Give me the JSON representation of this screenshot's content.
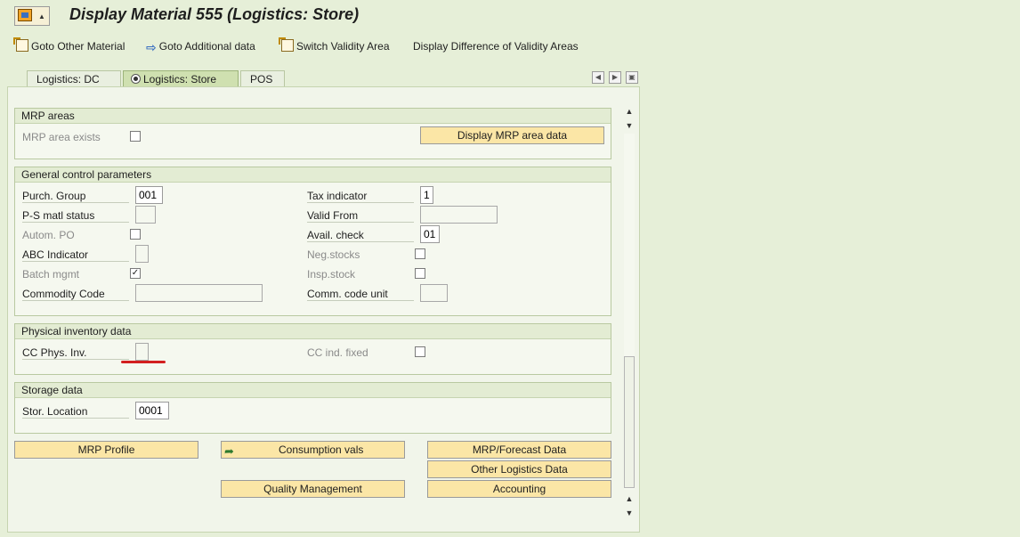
{
  "window": {
    "title": "Display Material 555 (Logistics: Store)"
  },
  "toolbar": {
    "items": [
      {
        "label": "Goto Other Material",
        "icon": "document-icon"
      },
      {
        "label": "Goto Additional data",
        "icon": "arrow-right-icon"
      },
      {
        "label": "Switch Validity Area",
        "icon": "document-icon"
      },
      {
        "label": "Display Difference of Validity Areas",
        "icon": ""
      }
    ]
  },
  "tabs": [
    {
      "label": "Logistics: DC",
      "active": false
    },
    {
      "label": "Logistics: Store",
      "active": true
    },
    {
      "label": "POS",
      "active": false
    }
  ],
  "mrp_areas": {
    "title": "MRP areas",
    "mrp_area_exists_label": "MRP area exists",
    "mrp_area_exists_checked": false,
    "display_button": "Display MRP area data"
  },
  "general": {
    "title": "General control parameters",
    "purch_group": {
      "label": "Purch. Group",
      "value": "001"
    },
    "ps_matl_status": {
      "label": "P-S matl status",
      "value": ""
    },
    "autom_po": {
      "label": "Autom. PO",
      "checked": false
    },
    "abc_indicator": {
      "label": "ABC Indicator",
      "value": ""
    },
    "batch_mgmt": {
      "label": "Batch mgmt",
      "checked": true,
      "mark": "✓"
    },
    "commodity_code": {
      "label": "Commodity Code",
      "value": ""
    },
    "tax_indicator": {
      "label": "Tax indicator",
      "value": "1"
    },
    "valid_from": {
      "label": "Valid From",
      "value": ""
    },
    "avail_check": {
      "label": "Avail. check",
      "value": "01"
    },
    "neg_stocks": {
      "label": "Neg.stocks",
      "checked": false
    },
    "insp_stock": {
      "label": "Insp.stock",
      "checked": false
    },
    "comm_code_unit": {
      "label": "Comm. code unit",
      "value": ""
    }
  },
  "physical_inventory": {
    "title": "Physical inventory data",
    "cc_phys_inv": {
      "label": "CC Phys. Inv.",
      "value": ""
    },
    "cc_ind_fixed": {
      "label": "CC ind. fixed",
      "checked": false
    }
  },
  "storage": {
    "title": "Storage data",
    "stor_location": {
      "label": "Stor. Location",
      "value": "0001"
    }
  },
  "buttons": {
    "mrp_profile": "MRP Profile",
    "consumption_vals": "Consumption vals",
    "mrp_forecast": "MRP/Forecast Data",
    "other_logistics": "Other Logistics Data",
    "quality_management": "Quality Management",
    "accounting": "Accounting"
  },
  "colors": {
    "background": "#e6efd8",
    "button": "#fbe6a6",
    "highlight_underline": "#d21f1f"
  }
}
